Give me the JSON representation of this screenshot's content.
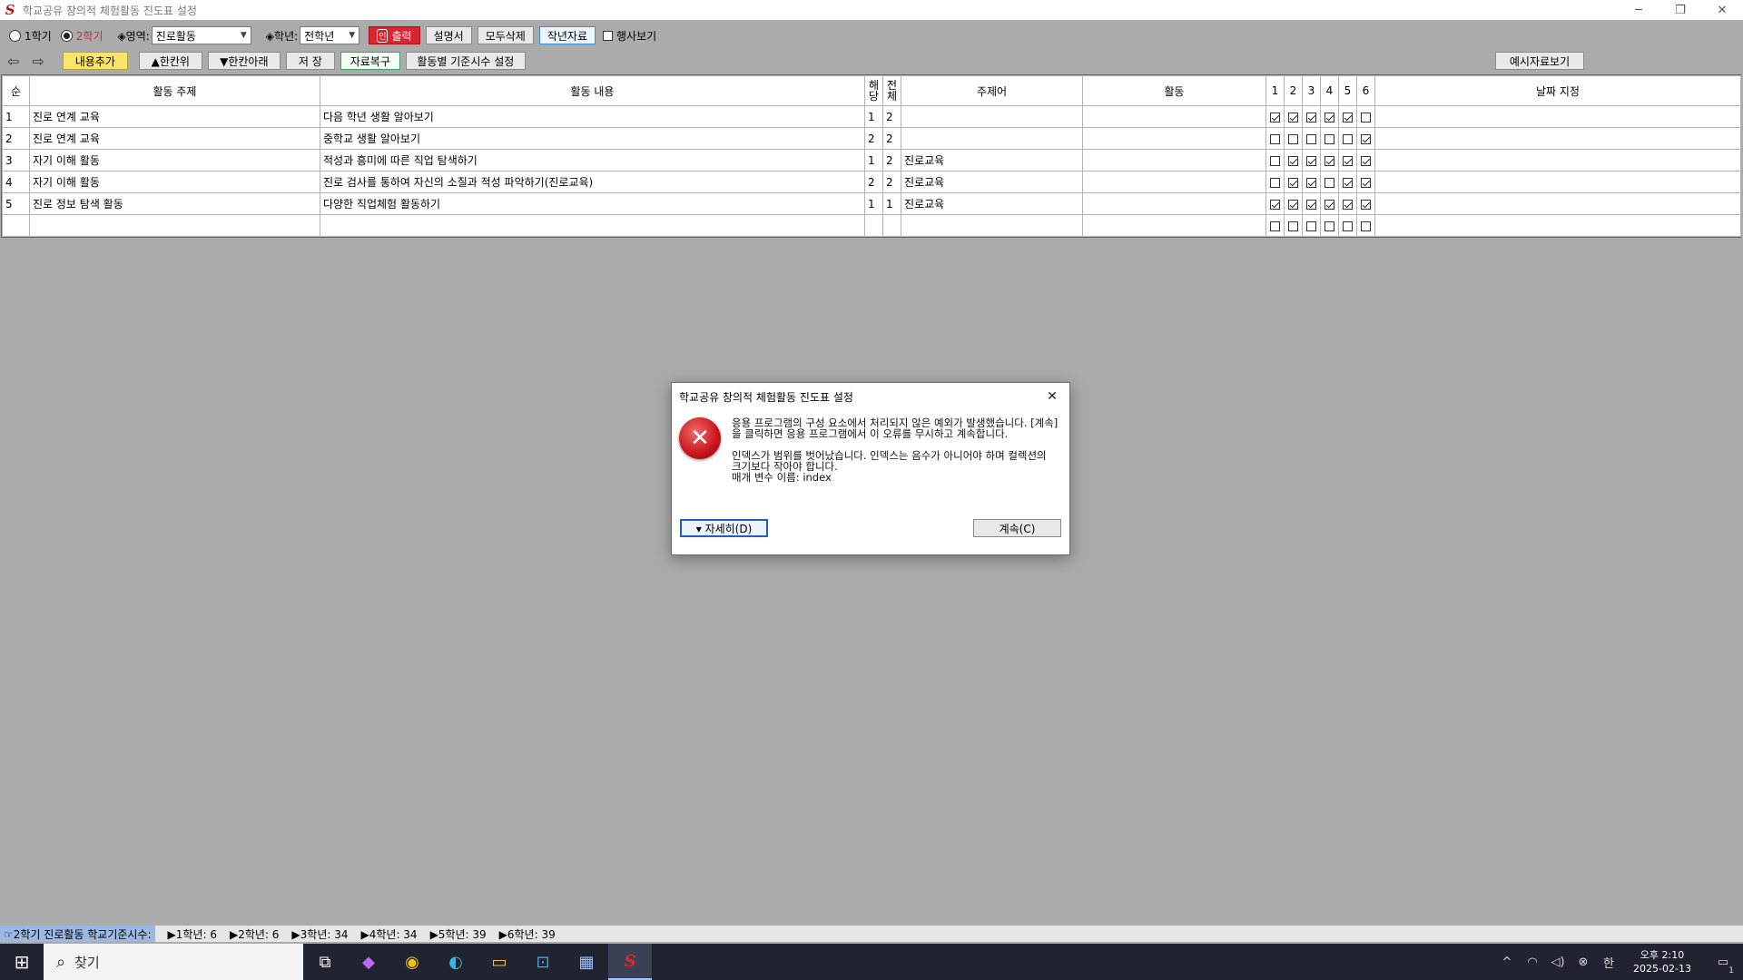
{
  "window": {
    "title": "학교공유 창의적 체험활동 진도표 설정",
    "logo_letter": "S",
    "minimize": "─",
    "restore": "❐",
    "close": "✕"
  },
  "toolbar": {
    "semester1": "1학기",
    "semester2": "2학기",
    "area_label": "◈영역:",
    "area_value": "진로활동",
    "grade_label": "◈학년:",
    "grade_value": "전학년",
    "print_icon": "인",
    "print": "출력",
    "manual": "설명서",
    "delete_all": "모두삭제",
    "last_year": "작년자료",
    "event_view": "행사보기",
    "add_content": "내용추가",
    "move_up": "▲한칸위",
    "move_down": "▼한칸아래",
    "save": "저 장",
    "restore_data": "자료복구",
    "standard_hours": "활동별 기준시수 설정",
    "sample_view": "예시자료보기",
    "nav_back": "⇦",
    "nav_forward": "⇨"
  },
  "grid": {
    "headers": {
      "no": "순",
      "topic": "활동 주제",
      "content": "활동 내용",
      "hd_a": "해",
      "hd_b": "당",
      "tot_a": "전",
      "tot_b": "체",
      "subject": "주제어",
      "activity": "활동",
      "g1": "1",
      "g2": "2",
      "g3": "3",
      "g4": "4",
      "g5": "5",
      "g6": "6",
      "date": "날짜 지정"
    },
    "rows": [
      {
        "no": "1",
        "topic": "진로 연계 교육",
        "content": "다음 학년 생활 알아보기",
        "hd": "1",
        "tot": "2",
        "subject": "",
        "activity": "",
        "checks": [
          true,
          true,
          true,
          true,
          true,
          false
        ]
      },
      {
        "no": "2",
        "topic": "진로 연계 교육",
        "content": "중학교 생활 알아보기",
        "hd": "2",
        "tot": "2",
        "subject": "",
        "activity": "",
        "checks": [
          false,
          false,
          false,
          false,
          false,
          true
        ]
      },
      {
        "no": "3",
        "topic": "자기 이해 활동",
        "content": "적성과 흥미에 따른 직업 탐색하기",
        "hd": "1",
        "tot": "2",
        "subject": "진로교육",
        "activity": "",
        "checks": [
          false,
          true,
          true,
          true,
          true,
          true
        ]
      },
      {
        "no": "4",
        "topic": "자기 이해 활동",
        "content": "진로 검사를 통하여 자신의 소질과 적성 파악하기(진로교육)",
        "hd": "2",
        "tot": "2",
        "subject": "진로교육",
        "activity": "",
        "checks": [
          false,
          true,
          true,
          false,
          true,
          true
        ]
      },
      {
        "no": "5",
        "topic": "진로 정보 탐색 활동",
        "content": "다양한 직업체험 활동하기",
        "hd": "1",
        "tot": "1",
        "subject": "진로교육",
        "activity": "",
        "checks": [
          true,
          true,
          true,
          true,
          true,
          true
        ]
      },
      {
        "no": "",
        "topic": "",
        "content": "",
        "hd": "",
        "tot": "",
        "subject": "",
        "activity": "",
        "checks": [
          false,
          false,
          false,
          false,
          false,
          false
        ]
      }
    ]
  },
  "statusbar": {
    "current": "☞2학기 진로활동 학교기준시수:",
    "items": [
      "▶1학년: 6",
      "▶2학년: 6",
      "▶3학년: 34",
      "▶4학년: 34",
      "▶5학년: 39",
      "▶6학년: 39"
    ]
  },
  "dialog": {
    "title": "학교공유 창의적 체험활동 진도표 설정",
    "close": "✕",
    "error_icon": "✕",
    "message1": "응용 프로그램의 구성 요소에서 처리되지 않은 예외가 발생했습니다. [계속]을 클릭하면 응용 프로그램에서 이 오류를 무시하고 계속합니다.",
    "message2a": "인덱스가 범위를 벗어났습니다. 인덱스는 음수가 아니어야 하며 컬렉션의 크기보다 작아야 합니다.",
    "message2b": "매개 변수 이름: index",
    "details": "▾ 자세히(D)",
    "continue": "계속(C)"
  },
  "taskbar": {
    "start_icon": "⊞",
    "search_icon": "⌕",
    "search": "찾기",
    "icons": [
      "⧉",
      "◆",
      "◉",
      "◐",
      "▭",
      "⊡",
      "▦",
      "S"
    ],
    "tray_up": "^",
    "tray_net": "◠",
    "tray_vol": "◁)",
    "tray_x": "⊗",
    "tray_ime": "한",
    "time": "오후 2:10",
    "date": "2025-02-13",
    "notify": "▭",
    "notify_count": "1"
  },
  "colors": {
    "accent_red": "#d8252f",
    "status_highlight": "#9db8e3",
    "taskbar": "#1f2430"
  }
}
